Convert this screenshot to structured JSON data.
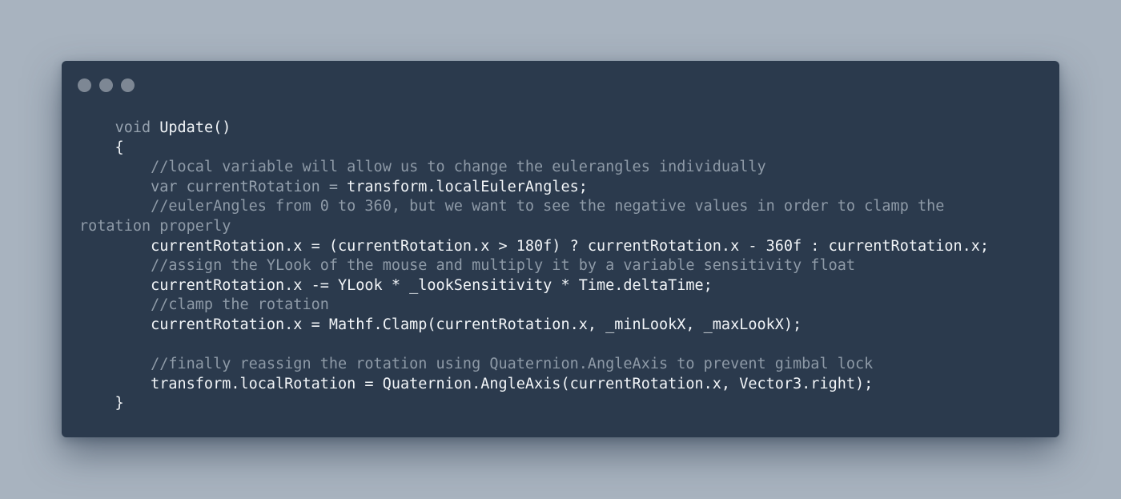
{
  "window": {
    "controls": [
      "close-dot",
      "minimize-dot",
      "maximize-dot"
    ]
  },
  "code": {
    "lines": [
      [
        {
          "t": "    ",
          "k": "plain"
        },
        {
          "t": "void",
          "k": "kw"
        },
        {
          "t": " Update()",
          "k": "plain"
        }
      ],
      [
        {
          "t": "    {",
          "k": "plain"
        }
      ],
      [
        {
          "t": "        //local variable will allow us to change the eulerangles individually",
          "k": "comment"
        }
      ],
      [
        {
          "t": "        ",
          "k": "plain"
        },
        {
          "t": "var",
          "k": "kw"
        },
        {
          "t": " currentRotation = ",
          "k": "kw"
        },
        {
          "t": "transform.localEulerAngles;",
          "k": "plain"
        }
      ],
      [
        {
          "t": "        //eulerAngles from 0 to 360, but we want to see the negative values in order to clamp the",
          "k": "comment"
        }
      ],
      [
        {
          "t": "rotation properly",
          "k": "comment"
        }
      ],
      [
        {
          "t": "        currentRotation.x = (currentRotation.x > 180f) ? currentRotation.x - 360f : currentRotation.x;",
          "k": "plain"
        }
      ],
      [
        {
          "t": "        //assign the YLook of the mouse and multiply it by a variable sensitivity float",
          "k": "comment"
        }
      ],
      [
        {
          "t": "        currentRotation.x -= YLook * _lookSensitivity * Time.deltaTime;",
          "k": "plain"
        }
      ],
      [
        {
          "t": "        //clamp the rotation",
          "k": "comment"
        }
      ],
      [
        {
          "t": "        currentRotation.x = Mathf.Clamp(currentRotation.x, _minLookX, _maxLookX);",
          "k": "plain"
        }
      ],
      [
        {
          "t": "",
          "k": "plain"
        }
      ],
      [
        {
          "t": "        //finally reassign the rotation using Quaternion.AngleAxis to prevent gimbal lock",
          "k": "comment"
        }
      ],
      [
        {
          "t": "        transform.localRotation = Quaternion.AngleAxis(currentRotation.x, Vector3.right);",
          "k": "plain"
        }
      ],
      [
        {
          "t": "    }",
          "k": "plain"
        }
      ]
    ]
  },
  "colors": {
    "background": "#a8b3bf",
    "window": "#2b3a4d",
    "text": "#f2f5f8",
    "keyword": "#95a1ae",
    "comment": "#8e9aa7",
    "dot": "#7d8794"
  }
}
